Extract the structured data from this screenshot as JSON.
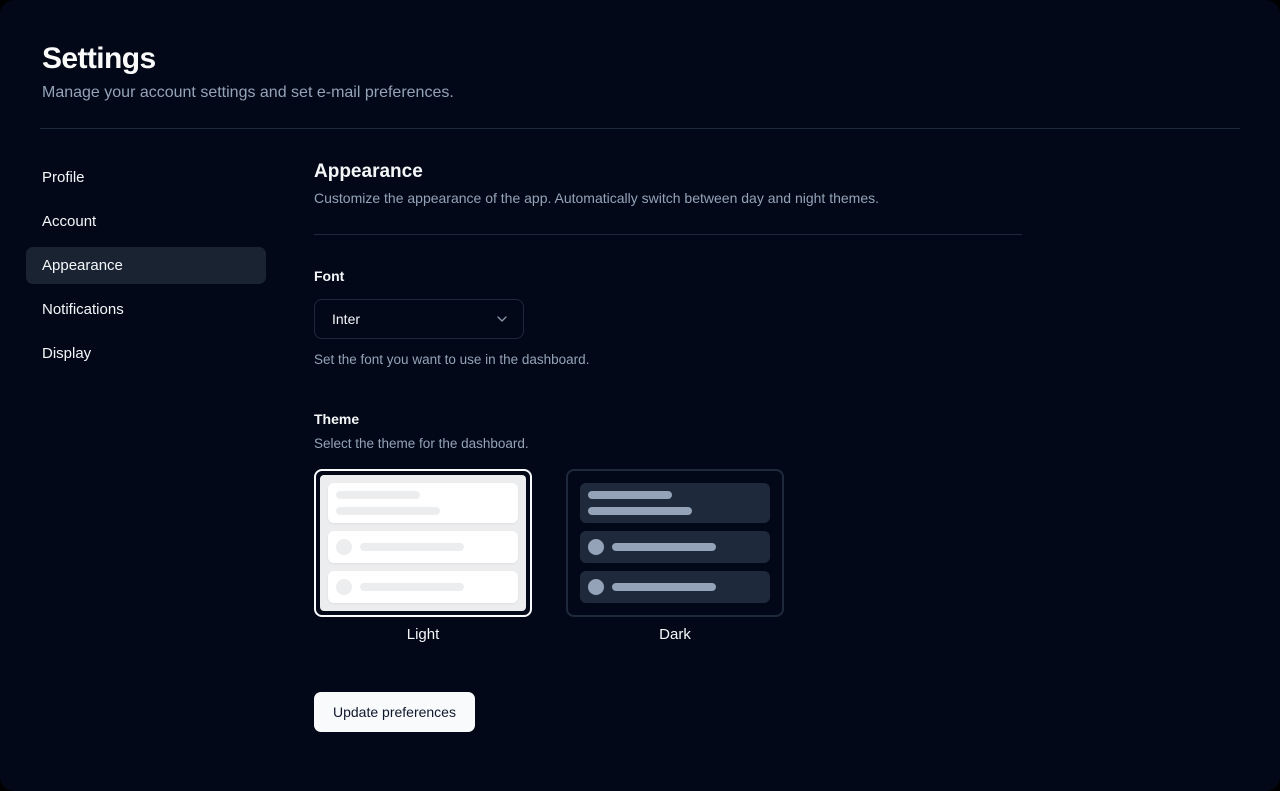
{
  "page": {
    "title": "Settings",
    "subtitle": "Manage your account settings and set e-mail preferences."
  },
  "sidebar": {
    "items": [
      {
        "label": "Profile",
        "active": false
      },
      {
        "label": "Account",
        "active": false
      },
      {
        "label": "Appearance",
        "active": true
      },
      {
        "label": "Notifications",
        "active": false
      },
      {
        "label": "Display",
        "active": false
      }
    ]
  },
  "section": {
    "title": "Appearance",
    "description": "Customize the appearance of the app. Automatically switch between day and night themes."
  },
  "font_field": {
    "label": "Font",
    "value": "Inter",
    "description": "Set the font you want to use in the dashboard."
  },
  "theme_field": {
    "label": "Theme",
    "description": "Select the theme for the dashboard.",
    "options": [
      {
        "label": "Light",
        "selected": true
      },
      {
        "label": "Dark",
        "selected": false
      }
    ]
  },
  "actions": {
    "update_button": "Update preferences"
  },
  "colors": {
    "background": "#020817",
    "foreground": "#f8fafc",
    "muted_foreground": "#94a3b8",
    "border": "#1e293b",
    "active_item_background": "#1a2332",
    "selected_theme_ring": "#f8fafc",
    "light_preview_panel": "#ecedef",
    "dark_preview_card": "#1e293b",
    "dark_preview_skeleton": "#94a3b8",
    "primary_button_background": "#f8fafc",
    "primary_button_text": "#0f172a"
  }
}
